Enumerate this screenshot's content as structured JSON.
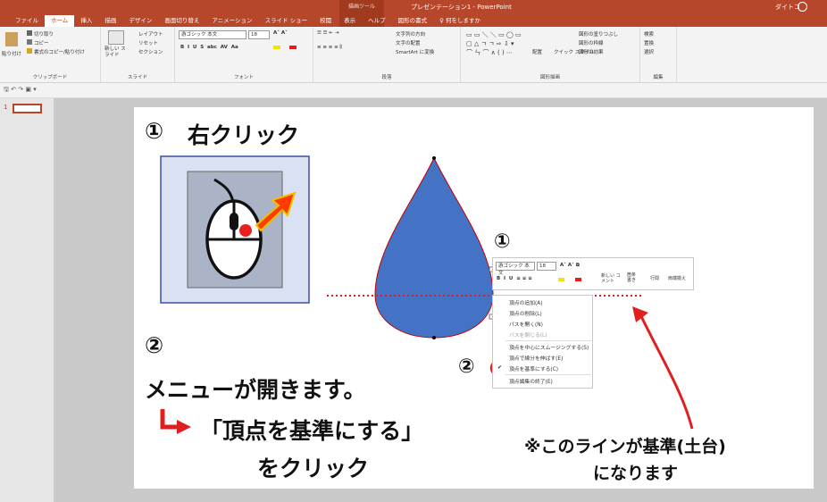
{
  "titlebar": {
    "context_tab": "描画ツール",
    "window_title": "プレゼンテーション1 - PowerPoint",
    "user": "ダイトコ",
    "accent": "#b7472a"
  },
  "tabs": [
    "ファイル",
    "ホーム",
    "挿入",
    "描画",
    "デザイン",
    "画面切り替え",
    "アニメーション",
    "スライド ショー",
    "校閲",
    "表示",
    "ヘルプ",
    "図形の書式",
    "♀ 何をしますか"
  ],
  "ribbon": {
    "clipboard": {
      "paste": "貼り付け",
      "cut": "切り取り",
      "copy": "コピー",
      "format_painter": "書式のコピー/貼り付け",
      "label": "クリップボード"
    },
    "slides": {
      "new_slide": "新しい スライド",
      "layout": "レイアウト",
      "reset": "リセット",
      "section": "セクション",
      "label": "スライド"
    },
    "font": {
      "name": "游ゴシック 本文",
      "size": "18",
      "label": "フォント"
    },
    "paragraph": {
      "text_direction": "文字列の方向",
      "align_text": "文字の配置",
      "smartart": "SmartArt に変換",
      "label": "段落"
    },
    "drawing": {
      "arrange": "配置",
      "quick_styles": "クイック スタイル",
      "fill": "図形の塗りつぶし",
      "outline": "図形の枠線",
      "effects": "図形の効果",
      "label": "図形描画"
    },
    "editing": {
      "find": "検索",
      "replace": "置換",
      "select": "選択",
      "label": "編集"
    }
  },
  "thumbs": {
    "number": "1"
  },
  "slide": {
    "step1_marker": "①",
    "step1_title": "右クリック",
    "step2_marker": "②",
    "step2_text": "メニューが開きます。",
    "step2_arrow": "↳",
    "step2_action": "「頂点を基準にする」",
    "step2_action_line2": "をクリック",
    "note_line1": "※このラインが基準(土台)",
    "note_line2": "になります",
    "overlay_marker1": "①",
    "overlay_marker2": "②"
  },
  "mini_toolbar": {
    "font": "游ゴシック 本文",
    "size": "18",
    "new_comment": "新しい コメント",
    "bullets": "箇条書き",
    "line_spacing": "行間",
    "justify": "両端揃え"
  },
  "context_menu": {
    "items": [
      {
        "label": "頂点の追加(A)",
        "disabled": false,
        "checked": false
      },
      {
        "label": "頂点の削除(L)",
        "disabled": false,
        "checked": false
      },
      {
        "label": "パスを開く(N)",
        "disabled": false,
        "checked": false
      },
      {
        "label": "パスを閉じる(L)",
        "disabled": true,
        "checked": false
      },
      {
        "label": "頂点を中心にスムージングする(S)",
        "disabled": false,
        "checked": false
      },
      {
        "label": "頂点で線分を伸ばす(E)",
        "disabled": false,
        "checked": false
      },
      {
        "label": "頂点を基準にする(C)",
        "disabled": false,
        "checked": true
      },
      {
        "label": "頂点編集の終了(E)",
        "disabled": false,
        "checked": false
      }
    ]
  },
  "colors": {
    "shape_fill": "#4472c4",
    "highlight_red": "#e02020",
    "mouse_bg": "#d9e1f2",
    "mouse_inner": "#aab4c6"
  }
}
